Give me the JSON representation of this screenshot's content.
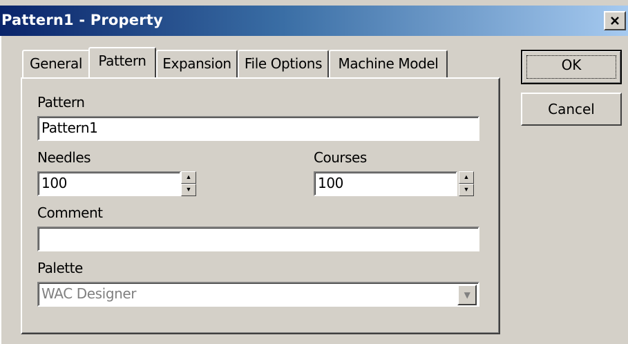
{
  "window": {
    "title": "Pattern1 - Property",
    "close_glyph": "✕"
  },
  "tabs": [
    {
      "label": "General",
      "active": false
    },
    {
      "label": "Pattern",
      "active": true
    },
    {
      "label": "Expansion",
      "active": false
    },
    {
      "label": "File Options",
      "active": false
    },
    {
      "label": "Machine Model",
      "active": false
    }
  ],
  "form": {
    "pattern_label": "Pattern",
    "pattern_value": "Pattern1",
    "needles_label": "Needles",
    "needles_value": "100",
    "courses_label": "Courses",
    "courses_value": "100",
    "comment_label": "Comment",
    "comment_value": "",
    "palette_label": "Palette",
    "palette_value": "WAC Designer",
    "palette_disabled": true
  },
  "buttons": {
    "ok_label": "OK",
    "cancel_label": "Cancel"
  },
  "icons": {
    "spin_up": "▲",
    "spin_down": "▼",
    "dropdown": "▼"
  }
}
